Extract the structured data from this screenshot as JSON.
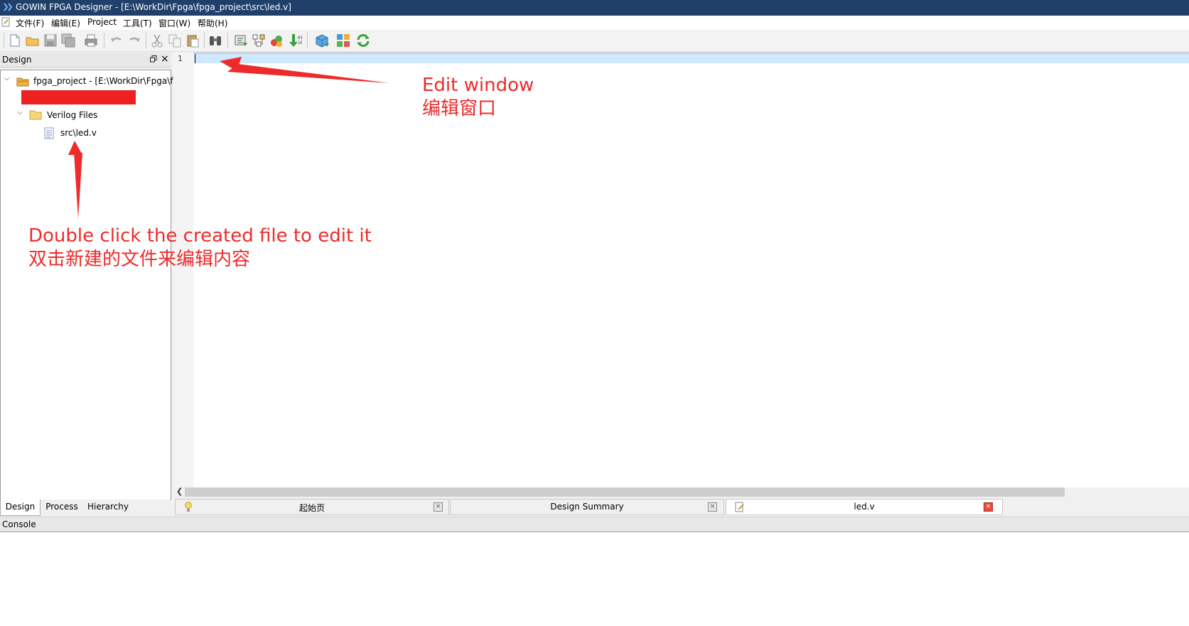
{
  "window": {
    "title": "GOWIN FPGA Designer - [E:\\WorkDir\\Fpga\\fpga_project\\src\\led.v]"
  },
  "menu": [
    {
      "label": "文件(F)"
    },
    {
      "label": "编辑(E)"
    },
    {
      "label": "Project"
    },
    {
      "label": "工具(T)"
    },
    {
      "label": "窗口(W)"
    },
    {
      "label": "帮助(H)"
    }
  ],
  "toolbar": {
    "icons": [
      "new-file-icon",
      "open-folder-icon",
      "save-icon",
      "save-all-icon",
      "print-icon",
      "undo-icon",
      "redo-icon",
      "cut-icon",
      "copy-icon",
      "paste-icon",
      "find-icon",
      "synthesize-icon",
      "floorplan-icon",
      "place-route-icon",
      "program-device-icon",
      "ip-core-icon",
      "layout-icon",
      "refresh-icon"
    ]
  },
  "design_panel": {
    "title": "Design",
    "project_label": "fpga_project - [E:\\WorkDir\\Fpga\\fpg...",
    "folder_label": "Verilog Files",
    "file_label": "src\\led.v",
    "tabs": [
      "Design",
      "Process",
      "Hierarchy"
    ]
  },
  "editor": {
    "line_number": "1"
  },
  "doc_tabs": [
    {
      "label": "起始页"
    },
    {
      "label": "Design Summary"
    },
    {
      "label": "led.v"
    }
  ],
  "console": {
    "title": "Console"
  },
  "annotations": {
    "edit_en": "Edit window",
    "edit_zh": "编辑窗口",
    "dbl_en": "Double click the created file to edit it",
    "dbl_zh": "双击新建的文件来编辑内容"
  },
  "colors": {
    "titlebar": "#20406a",
    "annotation": "#ee2b2b",
    "current_line": "#cde8ff",
    "close_active": "#e54b3c"
  }
}
